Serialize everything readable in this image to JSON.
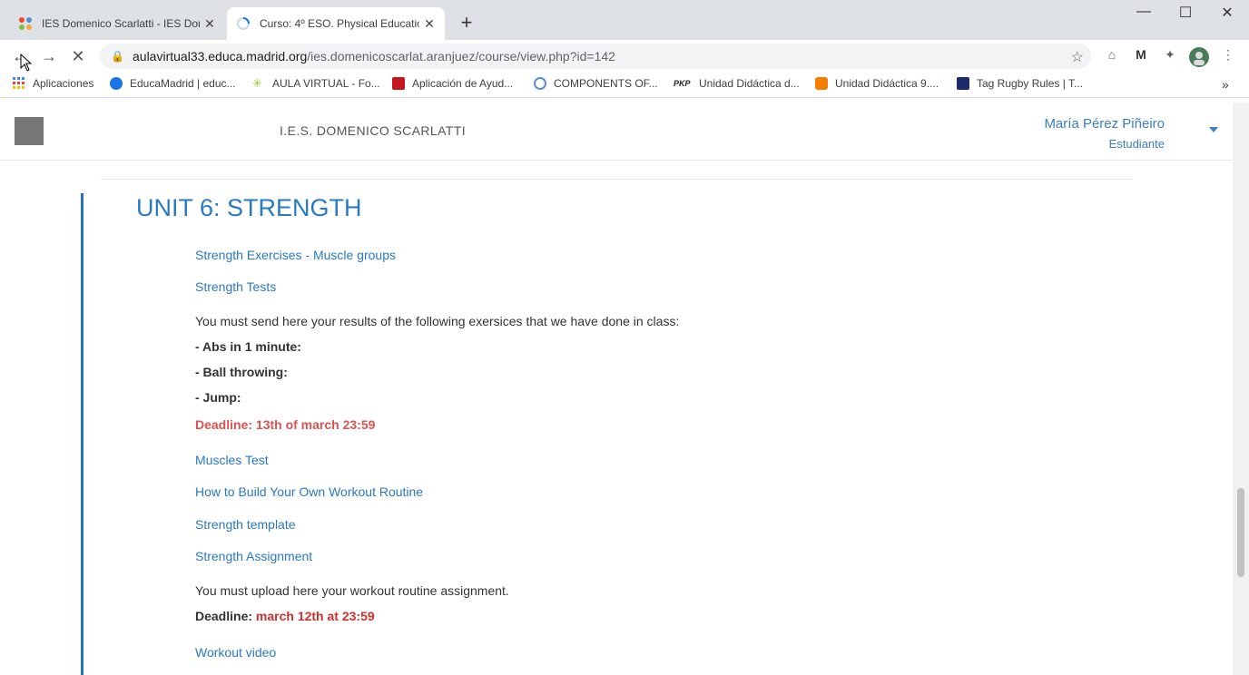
{
  "browser": {
    "tabs": [
      {
        "title": "IES Domenico Scarlatti - IES Dom",
        "active": false
      },
      {
        "title": "Curso: 4º ESO. Physical Educatio",
        "active": true
      }
    ],
    "new_tab": "+",
    "window_controls": {
      "minimize": "—",
      "maximize": "☐",
      "close": "✕"
    },
    "nav": {
      "back": "←",
      "forward": "→",
      "reload": "✕"
    },
    "url_host": "aulavirtual33.educa.madrid.org",
    "url_path": "/ies.domenicoscarlat.aranjuez/course/view.php?id=142",
    "bookmarks": [
      {
        "label": "Aplicaciones",
        "icon": "apps-grid-icon",
        "color": "#4285f4"
      },
      {
        "label": "EducaMadrid | educ...",
        "icon": "educamadrid-icon",
        "color": "#1a73e8"
      },
      {
        "label": "AULA VIRTUAL - Fo...",
        "icon": "aula-virtual-icon",
        "color": "#9acd32"
      },
      {
        "label": "Aplicación de Ayud...",
        "icon": "ayuda-icon",
        "color": "#c4161c"
      },
      {
        "label": "COMPONENTS OF...",
        "icon": "components-icon",
        "color": "#5b8cd6"
      },
      {
        "label": "Unidad Didáctica d...",
        "icon": "pkp-icon",
        "color": "#222"
      },
      {
        "label": "Unidad Didáctica 9....",
        "icon": "blogger-icon",
        "color": "#f57d00"
      },
      {
        "label": "Tag Rugby Rules | T...",
        "icon": "rugby-icon",
        "color": "#1b2a6b"
      }
    ],
    "bookmarks_more": "»"
  },
  "header": {
    "site_name": "I.E.S. DOMENICO SCARLATTI",
    "user_name": "María Pérez Piñeiro",
    "user_role": "Estudiante"
  },
  "section": {
    "title": "UNIT 6: STRENGTH",
    "items": {
      "link1": "Strength Exercises - Muscle groups",
      "link2": "Strength Tests",
      "text1": "You must send  here your results of the following exersices that we have done in class:",
      "b1": "- Abs in 1 minute:",
      "b2": "- Ball throwing:",
      "b3": "- Jump:",
      "deadline1": "Deadline: 13th of march 23:59",
      "link3": "Muscles Test",
      "link4": "How to Build Your Own Workout Routine",
      "link5": "Strength template",
      "link6": "Strength Assignment",
      "text2": "You must upload here your workout routine assignment.",
      "deadline2_label": "Deadline:",
      "deadline2_value": "march 12th at 23:59",
      "link7": "Workout video"
    }
  }
}
